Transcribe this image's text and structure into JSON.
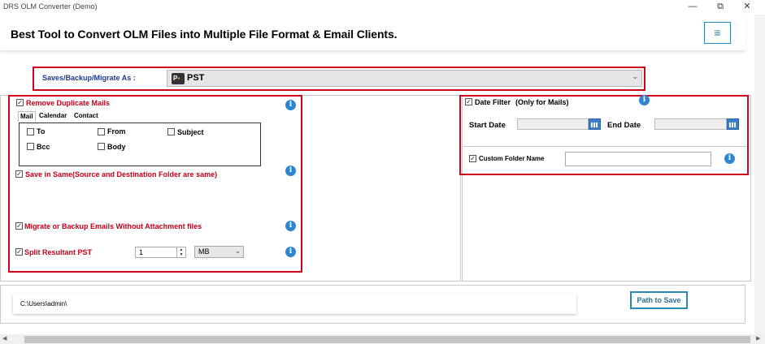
{
  "window": {
    "title": "DRS OLM Converter (Demo)",
    "minimize_glyph": "—",
    "restore_glyph": "⧉",
    "close_glyph": "✕"
  },
  "header": {
    "title": "Best Tool to Convert OLM Files into Multiple File Format & Email Clients.",
    "menu_glyph": "≡"
  },
  "save_as": {
    "label": "Saves/Backup/Migrate As :",
    "selected": "PST",
    "icon": "outlook-pst-icon"
  },
  "options": {
    "remove_duplicates": {
      "label": "Remove Duplicate Mails",
      "checked": true
    },
    "tabs": [
      "Mail",
      "Calendar",
      "Contact"
    ],
    "mail_fields": [
      {
        "label": "To",
        "checked": false
      },
      {
        "label": "From",
        "checked": false
      },
      {
        "label": "Subject",
        "checked": false
      },
      {
        "label": "Bcc",
        "checked": false
      },
      {
        "label": "Body",
        "checked": false
      }
    ],
    "save_in_same": {
      "label": "Save in Same(Source and Destination Folder are same)",
      "checked": true
    },
    "without_attachment": {
      "label": "Migrate or Backup Emails Without Attachment files",
      "checked": true
    },
    "split_pst": {
      "label": "Split Resultant PST",
      "checked": true,
      "value": "1",
      "unit": "MB"
    }
  },
  "filters": {
    "date_filter": {
      "label": "Date Filter",
      "note": "(Only for Mails)",
      "checked": true
    },
    "start_date_label": "Start Date",
    "end_date_label": "End Date",
    "start_date": "",
    "end_date": "",
    "custom_folder": {
      "label": "Custom Folder Name",
      "checked": true,
      "value": ""
    }
  },
  "destination": {
    "path": "C:\\Users\\admin\\",
    "button": "Path to Save"
  },
  "colors": {
    "highlight_red": "#d0021b",
    "accent_blue": "#2a8ab0",
    "info_blue": "#2e86d1",
    "label_red": "#c4001a"
  },
  "scrollbar": {
    "left_arrow": "◀",
    "right_arrow": "▶"
  }
}
